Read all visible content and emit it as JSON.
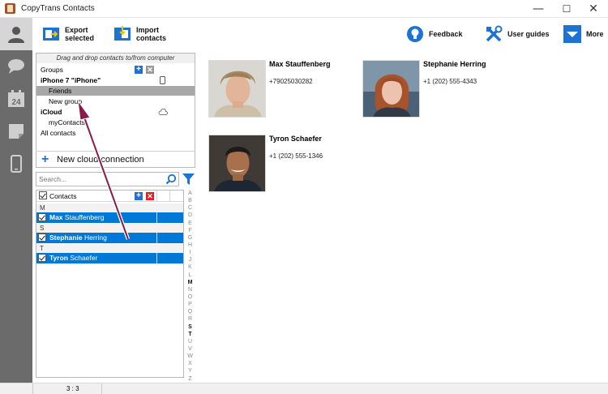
{
  "window": {
    "title": "CopyTrans Contacts",
    "controls": {
      "minimize": "—",
      "maximize": "☐",
      "close": "✕"
    }
  },
  "toolbar": {
    "export_label": "Export\nselected",
    "import_label": "Import\ncontacts",
    "feedback_label": "Feedback",
    "guides_label": "User guides",
    "more_label": "More"
  },
  "groups_panel": {
    "hint": "Drag and drop contacts to/from computer",
    "header": "Groups",
    "items": [
      {
        "label": "iPhone 7 \"iPhone\"",
        "bold": true
      },
      {
        "label": "Friends",
        "selected": true
      },
      {
        "label": "New group"
      },
      {
        "label": "iCloud",
        "bold": true
      },
      {
        "label": "myContacts"
      },
      {
        "label": "All contacts"
      }
    ],
    "new_cloud": "New cloud connection"
  },
  "search": {
    "placeholder": "Search..."
  },
  "contacts_list": {
    "header": "Contacts",
    "groups": [
      {
        "letter": "M",
        "first": "Max",
        "last": "Stauffenberg"
      },
      {
        "letter": "S",
        "first": "Stephanie",
        "last": "Herring"
      },
      {
        "letter": "T",
        "first": "Tyron",
        "last": "Schaefer"
      }
    ]
  },
  "alphabet": [
    "A",
    "B",
    "C",
    "D",
    "E",
    "F",
    "G",
    "H",
    "I",
    "J",
    "K",
    "L",
    "M",
    "N",
    "O",
    "P",
    "Q",
    "R",
    "S",
    "T",
    "U",
    "V",
    "W",
    "X",
    "Y",
    "Z",
    "#"
  ],
  "cards": [
    {
      "name": "Max Stauffenberg",
      "phone": "+79025030282"
    },
    {
      "name": "Stephanie Herring",
      "phone": "+1 (202) 555-4343"
    },
    {
      "name": "Tyron Schaefer",
      "phone": "+1 (202) 555-1346"
    }
  ],
  "status": {
    "count": "3 : 3"
  },
  "colors": {
    "accent": "#0078d7",
    "nav_bg": "#6b6b6b",
    "arrow": "#8b1a4a",
    "brand_blue": "#1e73d2"
  }
}
